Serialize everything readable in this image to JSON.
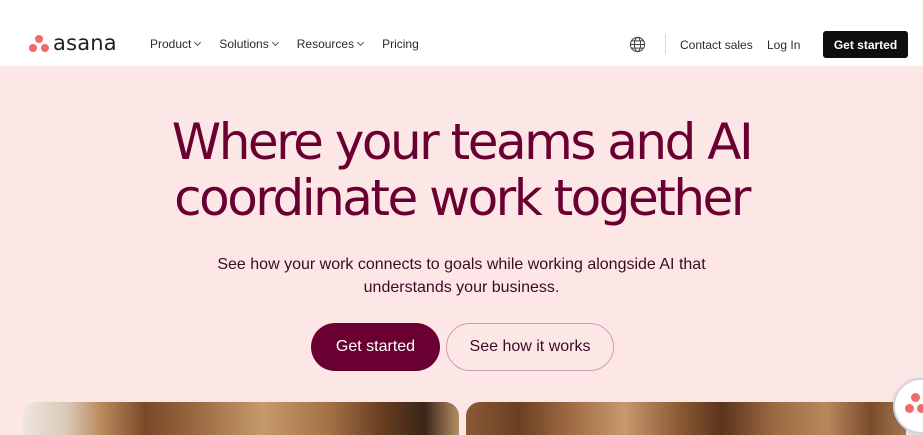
{
  "brand": {
    "name": "asana",
    "accent": "#f06a6a"
  },
  "nav": {
    "items": [
      {
        "label": "Product",
        "dropdown": true
      },
      {
        "label": "Solutions",
        "dropdown": true
      },
      {
        "label": "Resources",
        "dropdown": true
      },
      {
        "label": "Pricing",
        "dropdown": false
      }
    ],
    "language_icon": "globe-icon",
    "contact_label": "Contact sales",
    "login_label": "Log In",
    "cta_label": "Get started"
  },
  "hero": {
    "headline_line1": "Where your teams and AI",
    "headline_line2": "coordinate work together",
    "subtext": "See how your work connects to goals while working alongside AI that understands your business.",
    "primary_cta": "Get started",
    "secondary_cta": "See how it works",
    "colors": {
      "headline": "#690031",
      "background": "#fde7e6",
      "primary_button": "#690031"
    }
  }
}
